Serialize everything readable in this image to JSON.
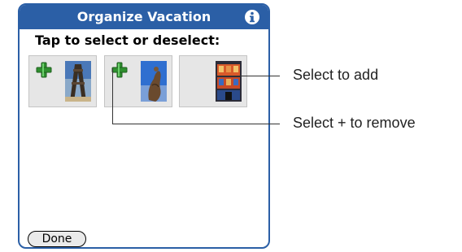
{
  "window": {
    "title": "Organize Vacation",
    "info_icon": "info-icon"
  },
  "prompt": "Tap to select or deselect:",
  "thumbnails": [
    {
      "selected": true,
      "photo": "bridge-tower-photo"
    },
    {
      "selected": true,
      "photo": "sculpture-photo"
    },
    {
      "selected": false,
      "photo": "building-photo"
    }
  ],
  "done_button": "Done",
  "callouts": {
    "add": "Select to add",
    "remove": "Select + to remove"
  },
  "colors": {
    "titlebar": "#2b5fa6",
    "plus_green": "#2f8f2f"
  }
}
